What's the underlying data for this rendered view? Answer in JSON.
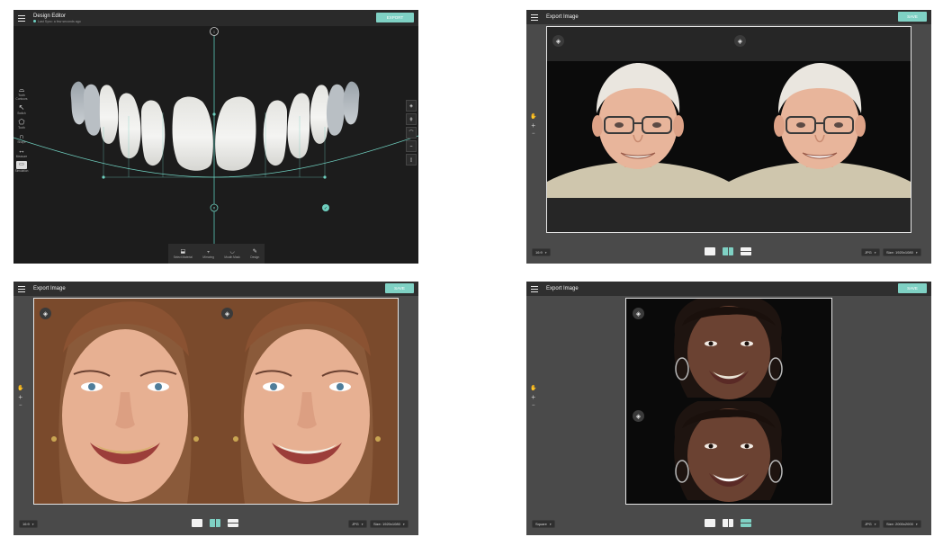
{
  "editor": {
    "title": "Design Editor",
    "sync_status": "Last Sync: a few seconds ago",
    "export_label": "EXPORT",
    "left_tools": [
      {
        "label": "Tooth Contours",
        "icon": "tooth-contours-icon",
        "glyph": "⌓"
      },
      {
        "label": "Switch",
        "icon": "cursor-icon",
        "glyph": "↖"
      },
      {
        "label": "Tooth",
        "icon": "tooth-outline-icon",
        "glyph": "⬠"
      },
      {
        "label": "Shape",
        "icon": "curve-shape-icon",
        "glyph": "∩"
      },
      {
        "label": "Measure",
        "icon": "ruler-icon",
        "glyph": "↔"
      },
      {
        "label": "Simulation",
        "icon": "simulation-icon",
        "glyph": "▭"
      }
    ],
    "right_tools": [
      {
        "icon": "layers-icon",
        "glyph": "◈"
      },
      {
        "icon": "grid-icon",
        "glyph": "⋕"
      },
      {
        "icon": "upper-arch-icon",
        "glyph": "⌒"
      },
      {
        "icon": "lower-arch-icon",
        "glyph": "⌣"
      },
      {
        "icon": "panel-icon",
        "glyph": "▯"
      }
    ],
    "bottom_tools": [
      {
        "label": "Select Material",
        "icon": "material-icon",
        "glyph": "⬓"
      },
      {
        "label": "Mirroring",
        "icon": "mirroring-icon",
        "glyph": "⫟"
      },
      {
        "label": "Mouth Mask",
        "icon": "mouth-mask-icon",
        "glyph": "◡"
      },
      {
        "label": "Design",
        "icon": "brush-icon",
        "glyph": "✎"
      }
    ]
  },
  "export_panels": [
    {
      "title": "Export Image",
      "save_label": "SAVE",
      "aspect": "16:9",
      "format": "JPG",
      "size": "Size: 1920x1080",
      "active_layout": 1
    },
    {
      "title": "Export Image",
      "save_label": "SAVE",
      "aspect": "16:9",
      "format": "JPG",
      "size": "Size: 1920x1080",
      "active_layout": 1
    },
    {
      "title": "Export Image",
      "save_label": "SAVE",
      "aspect": "Square",
      "format": "JPG",
      "size": "Size: 2000x2000",
      "active_layout": 2
    }
  ],
  "colors": {
    "accent": "#7fd1c4",
    "panel_bg": "#4a4a4a",
    "editor_bg": "#1c1c1c",
    "topbar": "#2f2f2f"
  }
}
